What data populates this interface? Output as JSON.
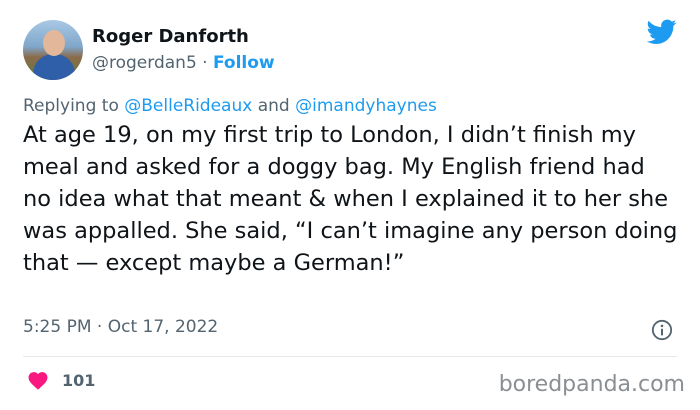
{
  "author": {
    "display_name": "Roger Danforth",
    "handle": "@rogerdan5",
    "separator": " · ",
    "follow_label": "Follow"
  },
  "reply": {
    "prefix": "Replying to ",
    "mention_1": "@BelleRideaux",
    "conjunction": " and ",
    "mention_2": "@imandyhaynes"
  },
  "tweet": {
    "text": "At age 19, on my first trip to London, I didn’t finish my meal and asked for a doggy bag. My English friend had no idea what that meant & when I explained it to her she was appalled. She said, “I can’t imagine any person doing that — except maybe a German!”",
    "time": "5:25 PM",
    "date_separator": " · ",
    "date": "Oct 17, 2022"
  },
  "engagement": {
    "likes": "101"
  },
  "watermark": "boredpanda.com",
  "icons": {
    "brand": "twitter-bird-icon",
    "info": "info-icon",
    "like": "heart-icon"
  },
  "colors": {
    "accent": "#1d9bf0",
    "heart": "#f91880",
    "muted": "#536471"
  }
}
